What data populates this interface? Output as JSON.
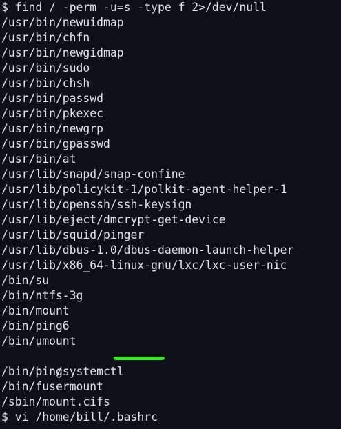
{
  "terminal": {
    "lines": [
      "$ find / -perm -u=s -type f 2>/dev/null",
      "/usr/bin/newuidmap",
      "/usr/bin/chfn",
      "/usr/bin/newgidmap",
      "/usr/bin/sudo",
      "/usr/bin/chsh",
      "/usr/bin/passwd",
      "/usr/bin/pkexec",
      "/usr/bin/newgrp",
      "/usr/bin/gpasswd",
      "/usr/bin/at",
      "/usr/lib/snapd/snap-confine",
      "/usr/lib/policykit-1/polkit-agent-helper-1",
      "/usr/lib/openssh/ssh-keysign",
      "/usr/lib/eject/dmcrypt-get-device",
      "/usr/lib/squid/pinger",
      "/usr/lib/dbus-1.0/dbus-daemon-launch-helper",
      "/usr/lib/x86_64-linux-gnu/lxc/lxc-user-nic",
      "/bin/su",
      "/bin/ntfs-3g",
      "/bin/mount",
      "/bin/ping6",
      "/bin/umount",
      "/bin/systemctl",
      "/bin/ping",
      "/bin/fusermount",
      "/sbin/mount.cifs",
      "$ vi /home/bill/.bashrc"
    ],
    "highlighted_line": "/bin/systemctl",
    "highlight_color": "#38e61f",
    "text_color": "#dfe3e8",
    "background_color": "#0d1117"
  }
}
